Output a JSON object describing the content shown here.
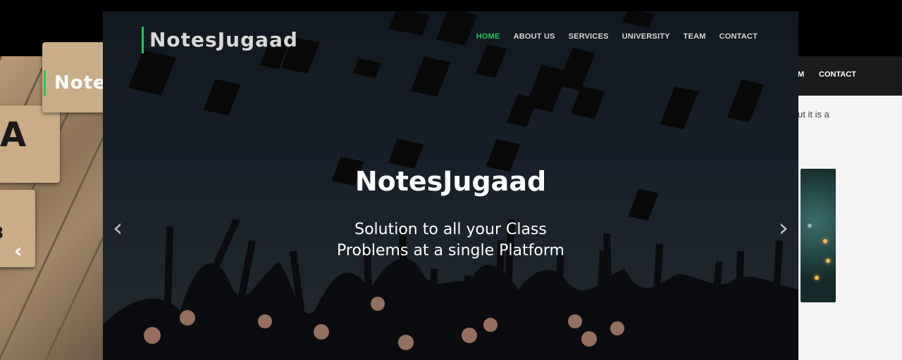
{
  "brand": "NotesJugaad",
  "nav": {
    "items": [
      "HOME",
      "ABOUT US",
      "SERVICES",
      "UNIVERSITY",
      "TEAM",
      "CONTACT"
    ],
    "active_index": 0
  },
  "hero": {
    "title": "NotesJugaad",
    "tagline_line1": "Solution to all your Class",
    "tagline_line2": "Problems at a single Platform",
    "prev_icon": "‹",
    "next_icon": "›"
  },
  "background_left": {
    "logo_fragment": "Note",
    "tile_letters": [
      "A",
      "3"
    ],
    "arrow_icon": "‹"
  },
  "background_right": {
    "nav_fragment": "M",
    "nav_contact": "CONTACT",
    "text_fragment": "ut it is a"
  },
  "colors": {
    "accent": "#22c55e",
    "nav_text": "#d6d6d6"
  }
}
